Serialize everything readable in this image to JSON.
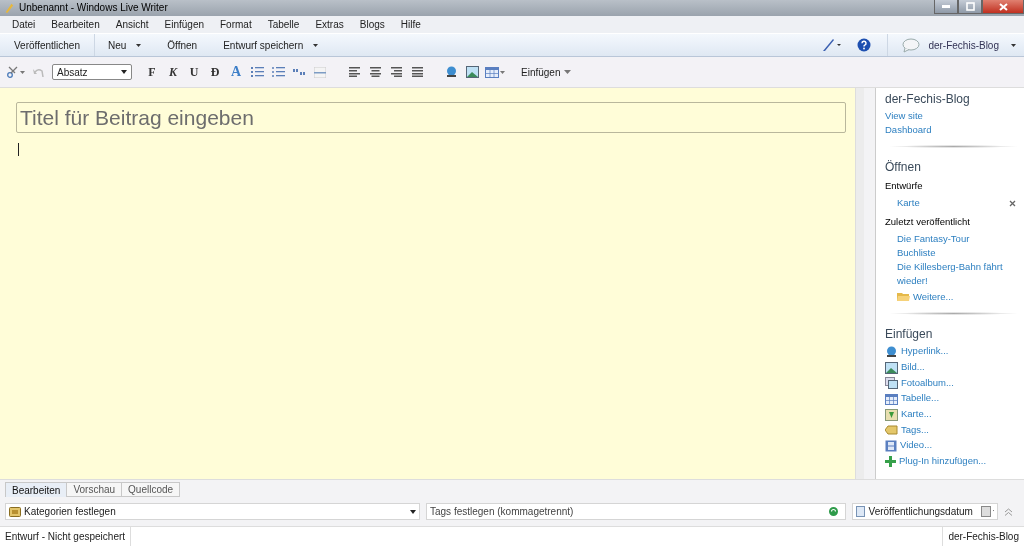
{
  "window": {
    "title": "Unbenannt - Windows Live Writer"
  },
  "menu": [
    "Datei",
    "Bearbeiten",
    "Ansicht",
    "Einfügen",
    "Format",
    "Tabelle",
    "Extras",
    "Blogs",
    "Hilfe"
  ],
  "commands": [
    {
      "label": "Veröffentlichen",
      "dropdown": false
    },
    {
      "label": "Neu",
      "dropdown": true
    },
    {
      "label": "Öffnen",
      "dropdown": false
    },
    {
      "label": "Entwurf speichern",
      "dropdown": true
    }
  ],
  "account": {
    "blog": "der-Fechis-Blog"
  },
  "format_bar": {
    "style": "Absatz",
    "text_buttons": [
      {
        "label": "F",
        "kind": "bold"
      },
      {
        "label": "K",
        "kind": "italic"
      },
      {
        "label": "U",
        "kind": "underline"
      },
      {
        "label": "Đ",
        "kind": "strike"
      },
      {
        "label": "A",
        "kind": "color"
      }
    ],
    "insert": "Einfügen"
  },
  "editor": {
    "title_placeholder": "Titel für Beitrag eingeben"
  },
  "sidebar": {
    "blog_name": "der-Fechis-Blog",
    "blog_links": [
      "View site",
      "Dashboard"
    ],
    "open": {
      "heading": "Öffnen",
      "drafts_heading": "Entwürfe",
      "drafts": [
        "Karte"
      ],
      "recent_heading": "Zuletzt veröffentlicht",
      "recent": [
        "Die Fantasy-Tour",
        "Buchliste",
        "Die Killesberg-Bahn fährt wieder!"
      ],
      "more": "Weitere..."
    },
    "insert": {
      "heading": "Einfügen",
      "items": [
        {
          "label": "Hyperlink...",
          "kind": "hyperlink"
        },
        {
          "label": "Bild...",
          "kind": "image"
        },
        {
          "label": "Fotoalbum...",
          "kind": "album"
        },
        {
          "label": "Tabelle...",
          "kind": "table"
        },
        {
          "label": "Karte...",
          "kind": "map"
        },
        {
          "label": "Tags...",
          "kind": "tag"
        },
        {
          "label": "Video...",
          "kind": "video"
        },
        {
          "label": "Plug-In hinzufügen...",
          "kind": "plugin"
        }
      ]
    }
  },
  "view_tabs": [
    {
      "label": "Bearbeiten",
      "selected": true
    },
    {
      "label": "Vorschau",
      "selected": false
    },
    {
      "label": "Quellcode",
      "selected": false
    }
  ],
  "properties": {
    "categories": "Kategorien festlegen",
    "tags_placeholder": "Tags festlegen (kommagetrennt)",
    "publish_date": {
      "label": "Veröffentlichungsdatum",
      "checked": false
    }
  },
  "status_bar": {
    "state": "Entwurf - Nicht gespeichert",
    "blog": "der-Fechis-Blog"
  }
}
